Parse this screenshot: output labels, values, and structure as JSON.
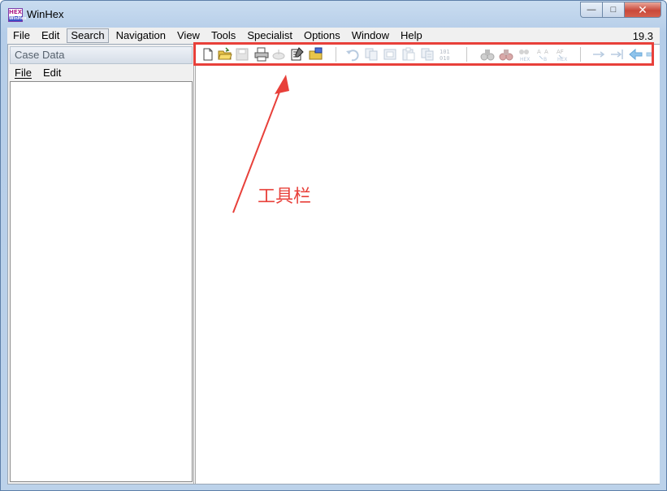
{
  "window": {
    "title": "WinHex"
  },
  "app_icon": {
    "top_text": "HEX",
    "bottom_text": "WinHex"
  },
  "window_buttons": {
    "minimize": "—",
    "maximize": "□",
    "close": "✕"
  },
  "menubar": {
    "items": [
      "File",
      "Edit",
      "Search",
      "Navigation",
      "View",
      "Tools",
      "Specialist",
      "Options",
      "Window",
      "Help"
    ],
    "active": "Search",
    "version": "19.3"
  },
  "case_panel": {
    "header": "Case Data",
    "menu": [
      "File",
      "Edit"
    ]
  },
  "toolbar": {
    "icons": [
      "new-file-icon",
      "open-folder-icon",
      "save-icon",
      "print-icon",
      "properties-icon",
      "edit-properties-icon",
      "open-disk-icon",
      "undo-icon",
      "cut-icon",
      "copy-icon",
      "paste-icon",
      "paste-write-icon",
      "binary-icon",
      "find-icon",
      "find-text-icon",
      "find-hex-icon",
      "replace-text-icon",
      "replace-hex-icon",
      "goto-icon",
      "goto-offset-icon",
      "back-icon",
      "forward-icon"
    ]
  },
  "annotation": {
    "label": "工具栏",
    "color": "#e8403a"
  }
}
